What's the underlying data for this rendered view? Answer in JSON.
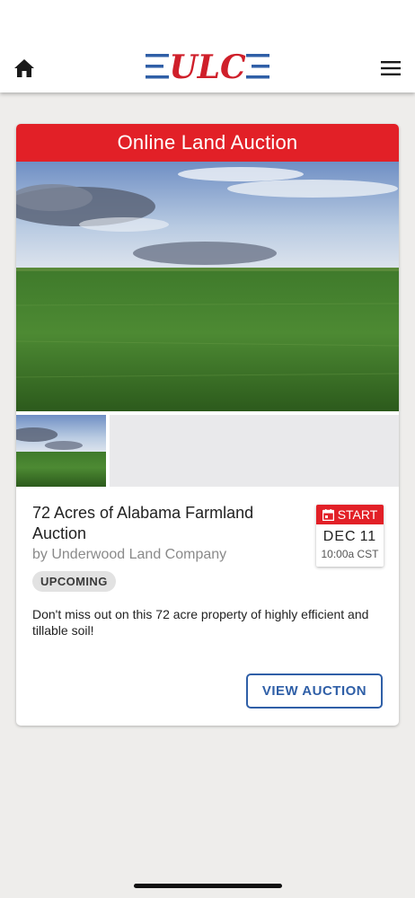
{
  "header": {
    "logo_text": "ULC",
    "home_icon": "home-icon",
    "menu_icon": "hamburger-menu-icon"
  },
  "listing": {
    "banner": "Online Land Auction",
    "title": "72 Acres of Alabama Farmland Auction",
    "byline": "by Underwood Land Company",
    "status": "UPCOMING",
    "description": "Don't miss out on this 72 acre property of highly efficient and tillable soil!",
    "start": {
      "label": "START",
      "month": "DEC",
      "day": "11",
      "time": "10:00a CST"
    },
    "button": "VIEW AUCTION"
  },
  "colors": {
    "accent_red": "#e22027",
    "brand_blue": "#2f5fa7",
    "logo_red": "#cf1f2a"
  }
}
